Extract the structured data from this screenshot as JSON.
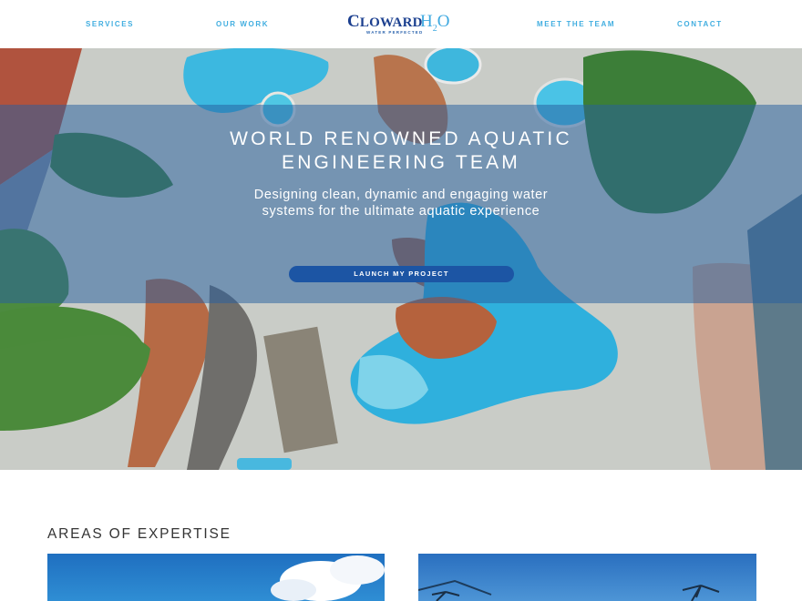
{
  "nav": {
    "links": [
      {
        "label": "SERVICES"
      },
      {
        "label": "OUR WORK"
      },
      {
        "label": "MEET THE TEAM"
      },
      {
        "label": "CONTACT"
      }
    ],
    "logo": {
      "name_big_c": "C",
      "name_rest": "LOWARD",
      "h2o": "H",
      "h2o_sub": "2",
      "h2o_o": "O",
      "tagline": "WATER PERFECTED"
    }
  },
  "hero": {
    "title_line1": "WORLD RENOWNED AQUATIC",
    "title_line2": "ENGINEERING TEAM",
    "subtitle_line1": "Designing clean, dynamic and engaging water",
    "subtitle_line2": "systems for the ultimate aquatic experience",
    "cta_label": "LAUNCH MY PROJECT"
  },
  "expertise": {
    "title": "AREAS OF EXPERTISE"
  },
  "colors": {
    "accent": "#41aee0",
    "brand": "#1b3f8f",
    "cta": "#1c55a4"
  }
}
